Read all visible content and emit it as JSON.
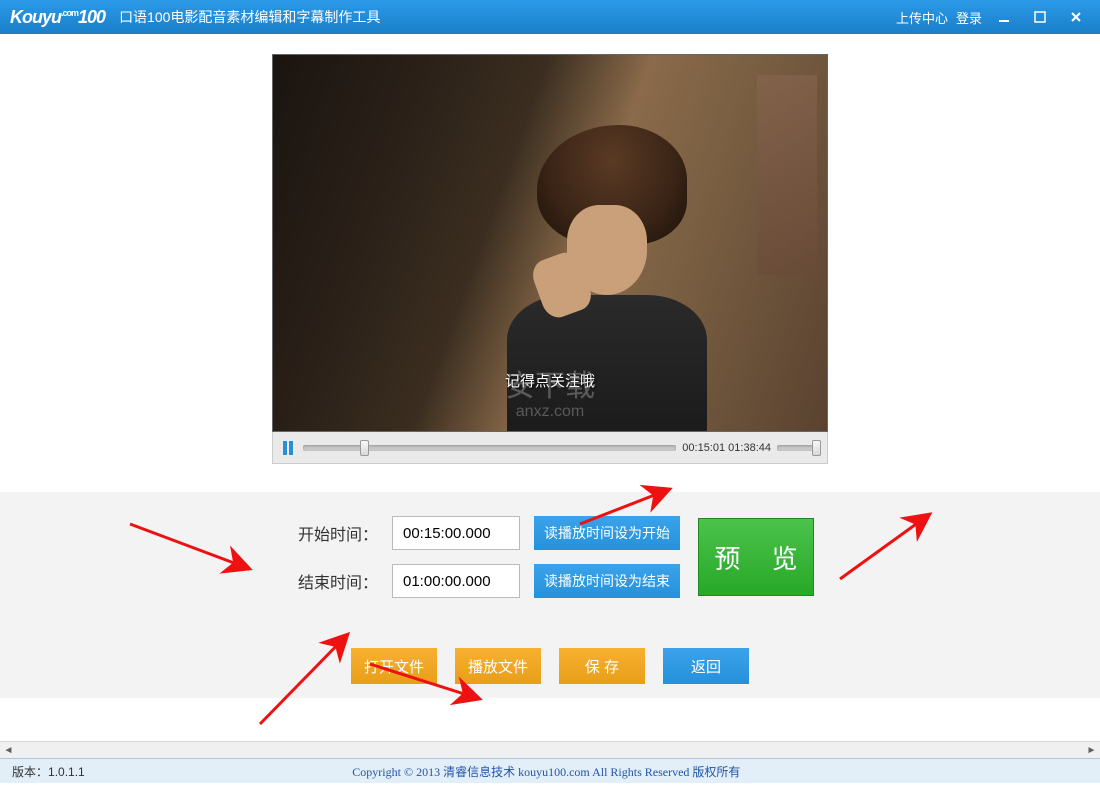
{
  "titlebar": {
    "logo_main": "Kouyu",
    "logo_com": ".com",
    "logo_num": "100",
    "app_title": "口语100电影配音素材编辑和字幕制作工具",
    "upload_center": "上传中心",
    "login": "登录"
  },
  "video": {
    "subtitle": "记得点关注哦",
    "watermark_main": "安下载",
    "watermark_sub": "anxz.com"
  },
  "player": {
    "current_time": "00:15:01",
    "total_time": "01:38:44"
  },
  "edit": {
    "start_label": "开始时间：",
    "end_label": "结束时间：",
    "start_value": "00:15:00.000",
    "end_value": "01:00:00.000",
    "set_start_btn": "读播放时间设为开始",
    "set_end_btn": "读播放时间设为结束",
    "preview_btn": "预 览"
  },
  "actions": {
    "open_file": "打开文件",
    "play_file": "播放文件",
    "save": "保 存",
    "return": "返回"
  },
  "footer": {
    "version_label": "版本：",
    "version_value": "1.0.1.1",
    "copyright": "Copyright © 2013 清睿信息技术 kouyu100.com All Rights Reserved 版权所有"
  }
}
